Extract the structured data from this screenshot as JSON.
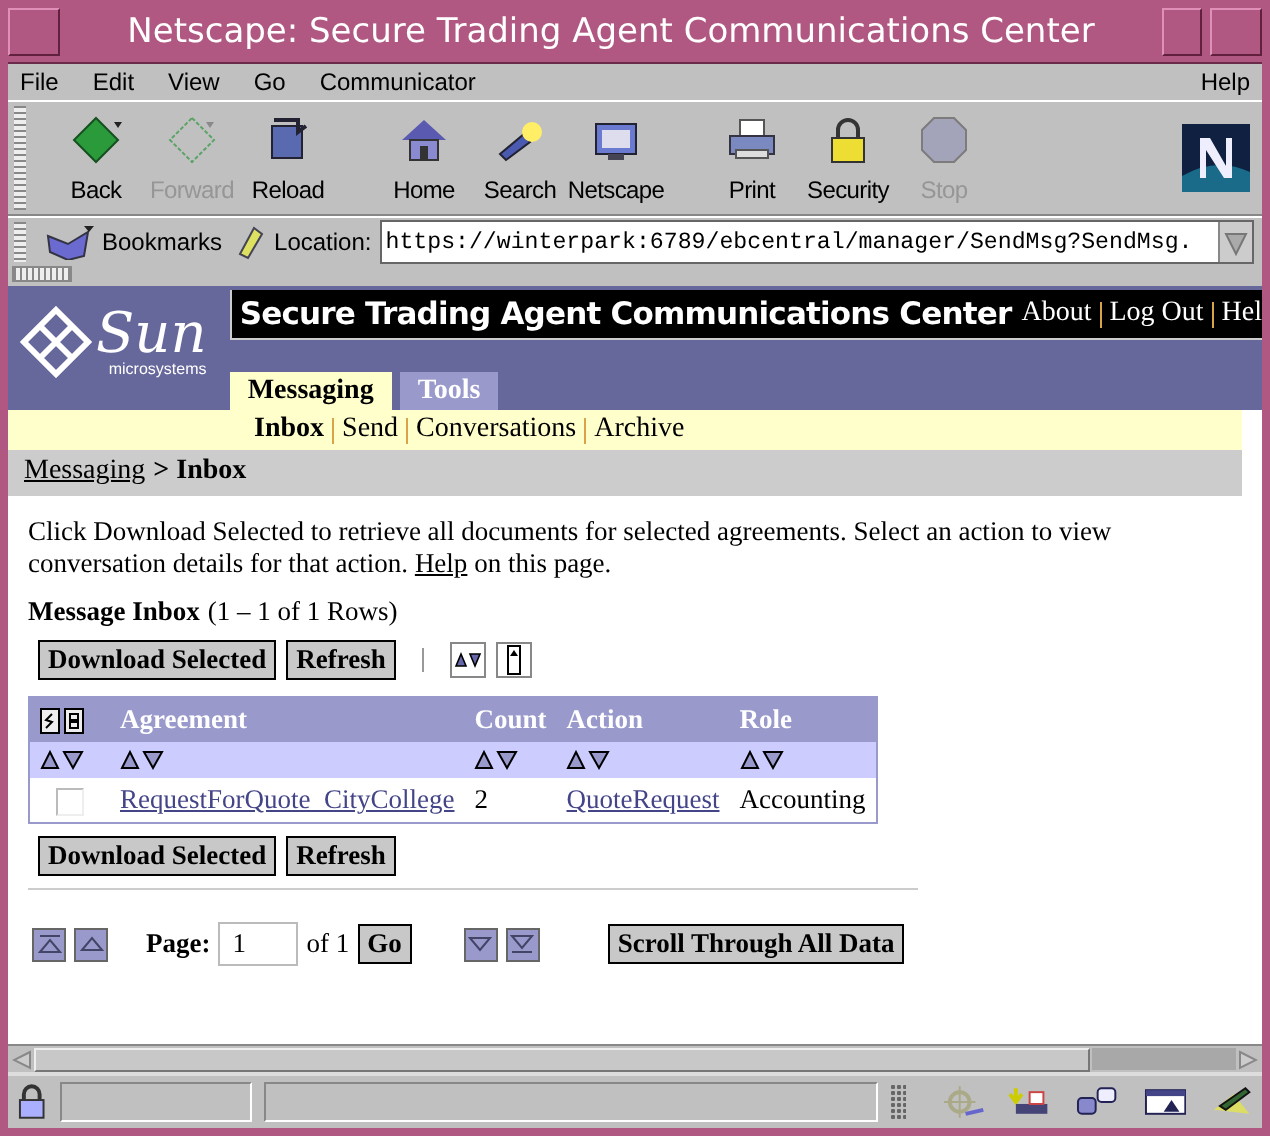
{
  "window": {
    "title": "Netscape: Secure Trading Agent Communications Center"
  },
  "menu_bar": {
    "items": [
      "File",
      "Edit",
      "View",
      "Go",
      "Communicator"
    ],
    "help": "Help"
  },
  "toolbar": [
    {
      "kind": "back",
      "label": "Back",
      "disabled": false
    },
    {
      "kind": "forward",
      "label": "Forward",
      "disabled": true
    },
    {
      "kind": "reload",
      "label": "Reload",
      "disabled": false
    },
    {
      "kind": "home",
      "label": "Home",
      "disabled": false
    },
    {
      "kind": "search",
      "label": "Search",
      "disabled": false
    },
    {
      "kind": "netscape",
      "label": "Netscape",
      "disabled": false
    },
    {
      "kind": "print",
      "label": "Print",
      "disabled": false
    },
    {
      "kind": "security",
      "label": "Security",
      "disabled": false
    },
    {
      "kind": "stop",
      "label": "Stop",
      "disabled": true
    }
  ],
  "location_bar": {
    "bookmarks": "Bookmarks",
    "label": "Location:",
    "url": "https://winterpark:6789/ebcentral/manager/SendMsg?SendMsg."
  },
  "page": {
    "logo": {
      "name": "Sun",
      "tagline": "microsystems"
    },
    "header": {
      "title": "Secure Trading Agent Communications Center",
      "links": [
        "About",
        "Log Out",
        "Hel"
      ]
    },
    "tabs": [
      {
        "label": "Messaging",
        "selected": true
      },
      {
        "label": "Tools",
        "selected": false
      }
    ],
    "subnav": [
      {
        "label": "Inbox",
        "selected": true
      },
      {
        "label": "Send",
        "selected": false
      },
      {
        "label": "Conversations",
        "selected": false
      },
      {
        "label": "Archive",
        "selected": false
      }
    ],
    "breadcrumb": {
      "parent": "Messaging",
      "separator": ">",
      "current": "Inbox"
    },
    "intro": {
      "before": "Click Download Selected to retrieve all documents for selected agreements. Select an action to view conversation details for that action.",
      "link": "Help",
      "after": "on this page."
    },
    "inbox_title": "Message Inbox",
    "row_range": "(1 – 1 of 1 Rows)",
    "buttons": [
      "Download Selected",
      "Refresh"
    ],
    "table": {
      "columns": [
        "Agreement",
        "Count",
        "Action",
        "Role"
      ],
      "rows": [
        {
          "checked": false,
          "agreement": "RequestForQuote_CityCollege",
          "count": "2",
          "action": "QuoteRequest",
          "role": "Accounting"
        }
      ]
    },
    "bottom_buttons": [
      "Download Selected",
      "Refresh"
    ],
    "pagination": {
      "label": "Page:",
      "page": "1",
      "of": "of 1",
      "go": "Go",
      "scroll": "Scroll Through All Data"
    }
  }
}
